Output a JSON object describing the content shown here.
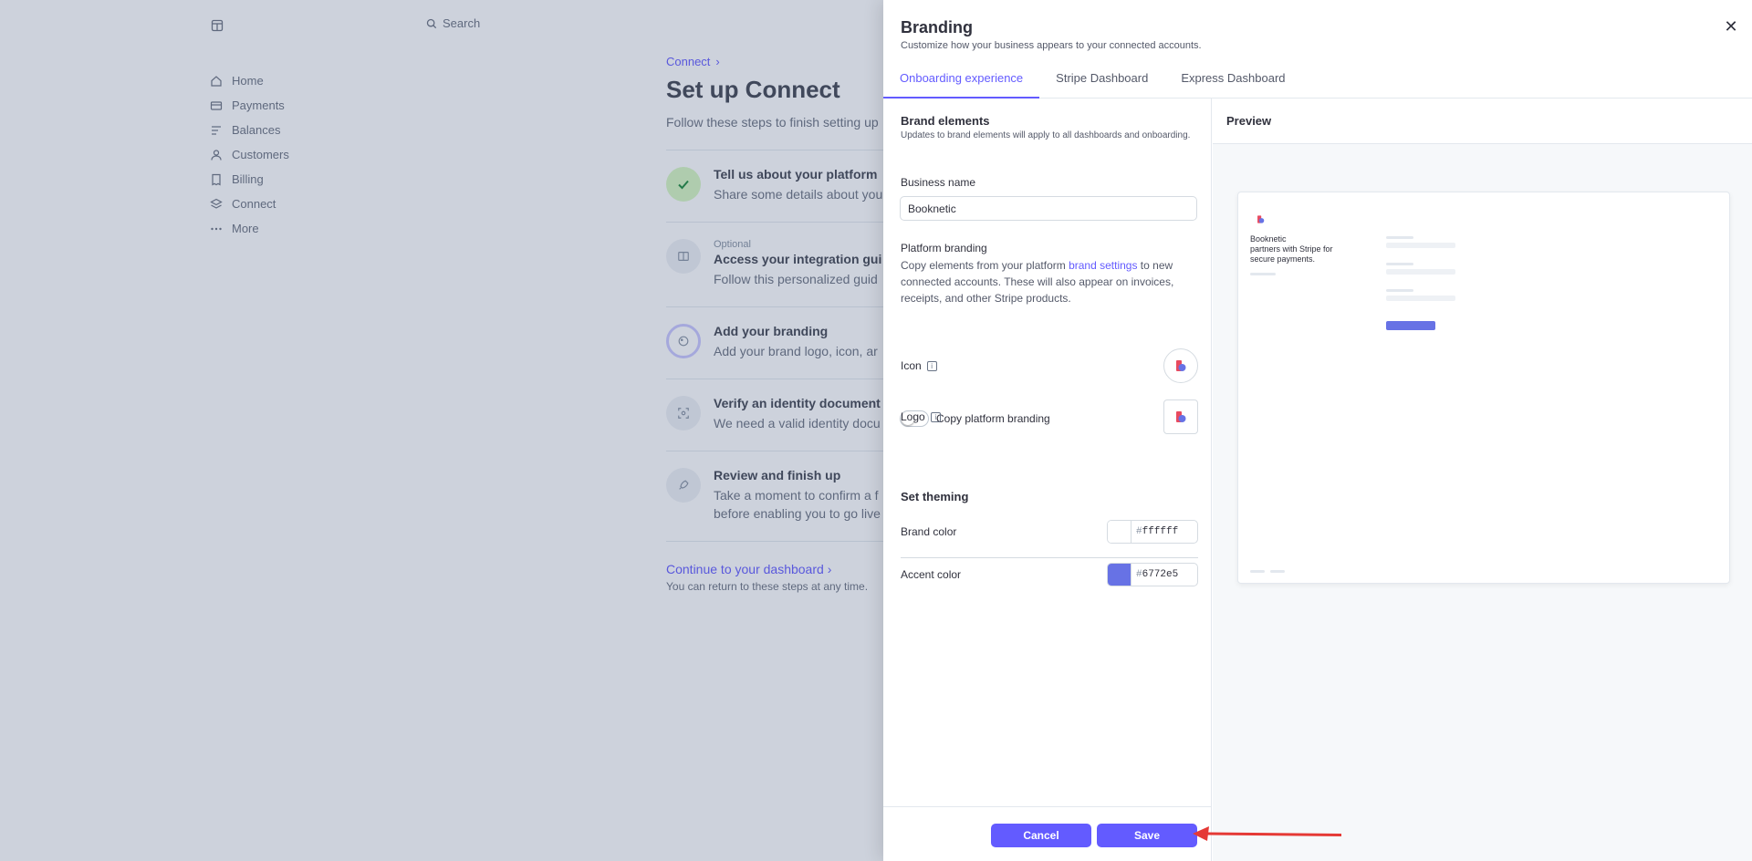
{
  "background": {
    "search_placeholder": "Search",
    "nav": [
      {
        "label": "Home",
        "icon": "home-icon"
      },
      {
        "label": "Payments",
        "icon": "card-icon"
      },
      {
        "label": "Balances",
        "icon": "balances-icon"
      },
      {
        "label": "Customers",
        "icon": "user-icon"
      },
      {
        "label": "Billing",
        "icon": "billing-icon"
      },
      {
        "label": "Connect",
        "icon": "connect-icon"
      },
      {
        "label": "More",
        "icon": "more-icon"
      }
    ],
    "breadcrumb": "Connect",
    "title": "Set up Connect",
    "subtitle": "Follow these steps to finish setting up",
    "steps": [
      {
        "optional": "",
        "title": "Tell us about your platform",
        "desc": "Share some details about you"
      },
      {
        "optional": "Optional",
        "title": "Access your integration gui",
        "desc": "Follow this personalized guid"
      },
      {
        "optional": "",
        "title": "Add your branding",
        "desc": "Add your brand logo, icon, ar"
      },
      {
        "optional": "",
        "title": "Verify an identity document",
        "desc": "We need a valid identity docu"
      },
      {
        "optional": "",
        "title": "Review and finish up",
        "desc": "Take a moment to confirm a f",
        "desc2": "before enabling you to go live"
      }
    ],
    "continue_link": "Continue to your dashboard",
    "continue_sub": "You can return to these steps at any time."
  },
  "modal": {
    "title": "Branding",
    "subtitle": "Customize how your business appears to your connected accounts.",
    "tabs": [
      "Onboarding experience",
      "Stripe Dashboard",
      "Express Dashboard"
    ],
    "brand_elements": {
      "heading": "Brand elements",
      "note": "Updates to brand elements will apply to all dashboards and onboarding.",
      "business_name_label": "Business name",
      "business_name_value": "Booknetic",
      "platform_branding_label": "Platform branding",
      "platform_branding_text_1": "Copy elements from your platform ",
      "platform_branding_link": "brand settings",
      "platform_branding_text_2": " to new connected accounts. These will also appear on invoices, receipts, and other Stripe products.",
      "toggle_label": "Copy platform branding",
      "toggle_on": false,
      "icon_label": "Icon",
      "logo_label": "Logo"
    },
    "theming": {
      "heading": "Set theming",
      "brand_color_label": "Brand color",
      "brand_color": "ffffff",
      "accent_color_label": "Accent color",
      "accent_color": "6772e5"
    },
    "buttons": {
      "cancel": "Cancel",
      "save": "Save"
    },
    "preview": {
      "heading": "Preview",
      "business": "Booknetic",
      "text": "partners with Stripe for secure payments."
    }
  },
  "colors": {
    "accent": "#635bff",
    "preview_accent": "#6772e5",
    "annotation_arrow": "#e53935"
  }
}
